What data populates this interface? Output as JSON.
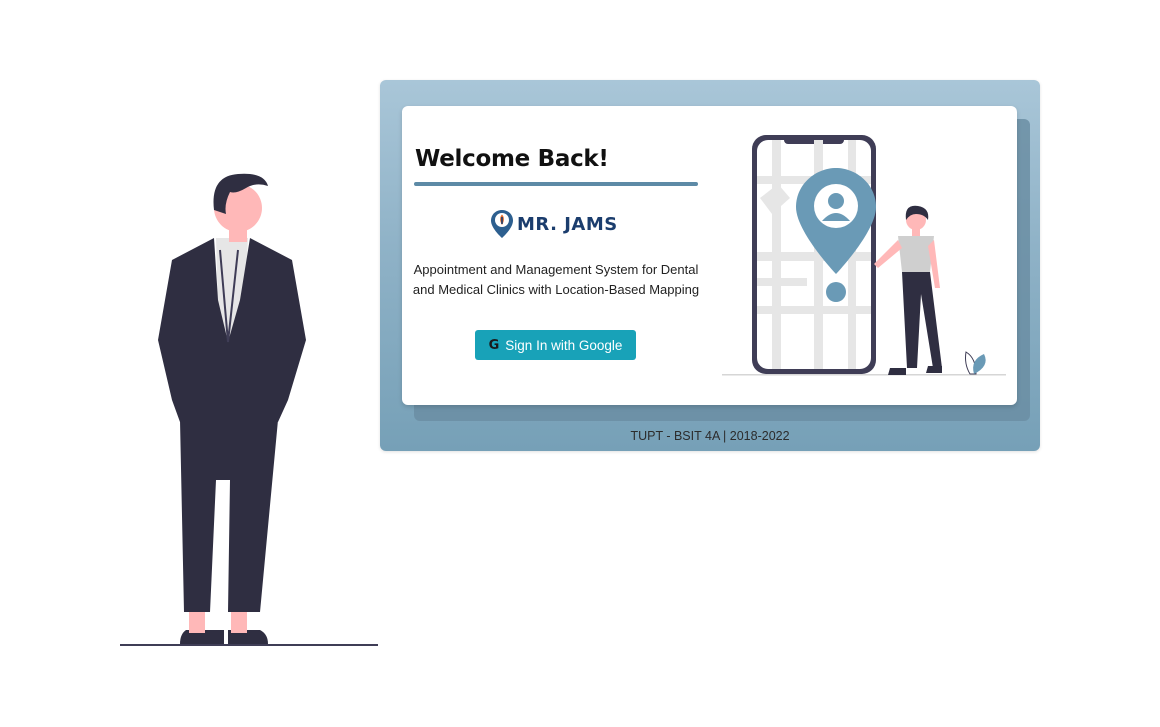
{
  "card": {
    "title": "Welcome Back!",
    "brand_name": "MR. JAMS",
    "description": "Appointment and Management System for Dental and Medical Clinics with Location-Based Mapping",
    "sign_in_label": "Sign In with Google",
    "sign_in_icon": "G"
  },
  "footer": {
    "text": "TUPT - BSIT 4A | 2018-2022"
  },
  "colors": {
    "accent": "#5d8aa6",
    "button": "#18a2b8",
    "brand_text": "#1b3d6d",
    "panel": "#8fb2c7",
    "figure_dark": "#2f2e41",
    "skin": "#ffb8b8"
  },
  "icons": {
    "brand_logo": "map-pin-logo-icon",
    "button_icon": "google-g-icon"
  }
}
